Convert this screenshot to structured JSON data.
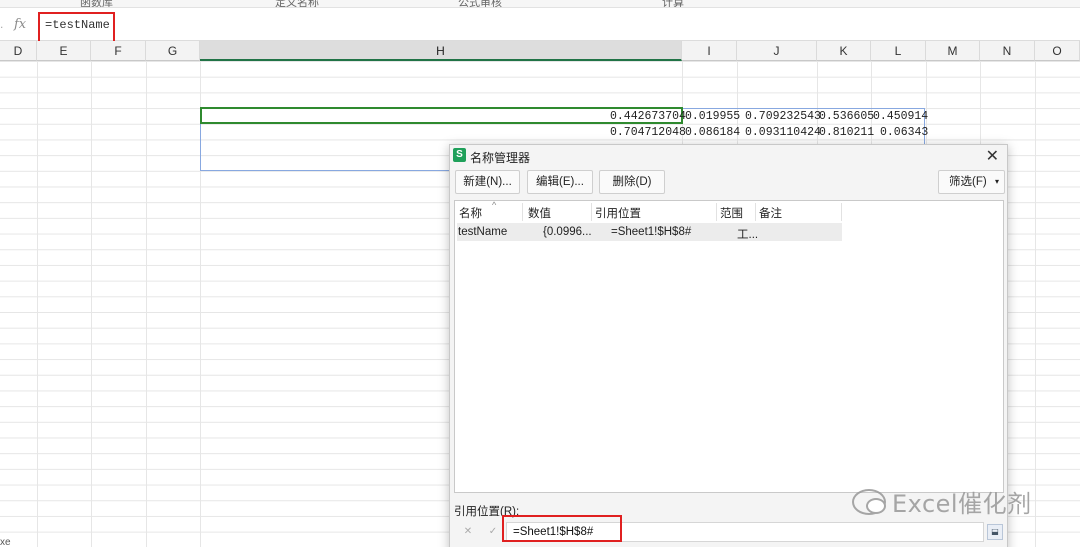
{
  "ribbon": {
    "labels": [
      "函数库",
      "定义名称",
      "公式审核",
      "计算"
    ]
  },
  "formula_bar": {
    "left_text": ".",
    "fx_icon": "fx",
    "formula": "=testName"
  },
  "columns": [
    "D",
    "E",
    "F",
    "G",
    "H",
    "I",
    "J",
    "K",
    "L",
    "M",
    "N",
    "O"
  ],
  "selected_column": "H",
  "cells": {
    "row8": [
      "0.442673704",
      "0.019955",
      "0.709232543",
      "0.536605",
      "0.450914"
    ],
    "row9": [
      "0.704712048",
      "0.086184",
      "0.093110424",
      "0.810211",
      "0.06343"
    ]
  },
  "dialog": {
    "icon": "S",
    "title": "名称管理器",
    "close": "✕",
    "buttons": {
      "new": "新建(N)...",
      "edit": "编辑(E)...",
      "delete": "删除(D)",
      "filter": "筛选(F)",
      "filter_caret": "▾"
    },
    "list": {
      "sort_caret": "^",
      "headers": [
        "名称",
        "数值",
        "引用位置",
        "范围",
        "备注"
      ],
      "rows": [
        {
          "name": "testName",
          "value": "{0.0996...",
          "refers_to": "=Sheet1!$H$8#",
          "scope": "工...",
          "comment": ""
        }
      ]
    },
    "refers_label": "引用位置(R):",
    "refers_value": "=Sheet1!$H$8#",
    "refers_cancel": "✕",
    "refers_ok": "✓",
    "refers_picker": "⬓"
  },
  "watermark": "Excel催化剂",
  "bottom_left_text": "xe"
}
